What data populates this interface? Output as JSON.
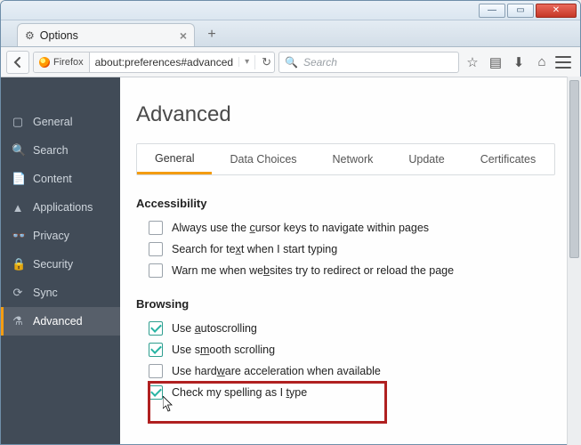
{
  "window": {
    "tab_title": "Options",
    "url": "about:preferences#advanced",
    "identity_label": "Firefox",
    "search_placeholder": "Search"
  },
  "sidebar": {
    "items": [
      {
        "icon": "▢",
        "label": "General"
      },
      {
        "icon": "🔍",
        "label": "Search"
      },
      {
        "icon": "📄",
        "label": "Content"
      },
      {
        "icon": "▲",
        "label": "Applications"
      },
      {
        "icon": "👓",
        "label": "Privacy"
      },
      {
        "icon": "🔒",
        "label": "Security"
      },
      {
        "icon": "⟳",
        "label": "Sync"
      },
      {
        "icon": "⚗",
        "label": "Advanced"
      }
    ],
    "active_index": 7
  },
  "page": {
    "title": "Advanced",
    "tabs": [
      "General",
      "Data Choices",
      "Network",
      "Update",
      "Certificates"
    ],
    "active_tab": 0,
    "sections": {
      "accessibility": {
        "heading": "Accessibility",
        "items": [
          {
            "checked": false,
            "label_pre": "Always use the ",
            "u": "c",
            "label_post": "ursor keys to navigate within pages"
          },
          {
            "checked": false,
            "label_pre": "Search for te",
            "u": "x",
            "label_post": "t when I start typing"
          },
          {
            "checked": false,
            "label_pre": "Warn me when we",
            "u": "b",
            "label_post": "sites try to redirect or reload the page"
          }
        ]
      },
      "browsing": {
        "heading": "Browsing",
        "items": [
          {
            "checked": true,
            "label_pre": "Use ",
            "u": "a",
            "label_post": "utoscrolling"
          },
          {
            "checked": true,
            "label_pre": "Use s",
            "u": "m",
            "label_post": "ooth scrolling"
          },
          {
            "checked": false,
            "label_pre": "Use hard",
            "u": "w",
            "label_post": "are acceleration when available"
          },
          {
            "checked": true,
            "label_pre": "Check my spelling as I ",
            "u": "t",
            "label_post": "ype"
          }
        ]
      }
    }
  }
}
